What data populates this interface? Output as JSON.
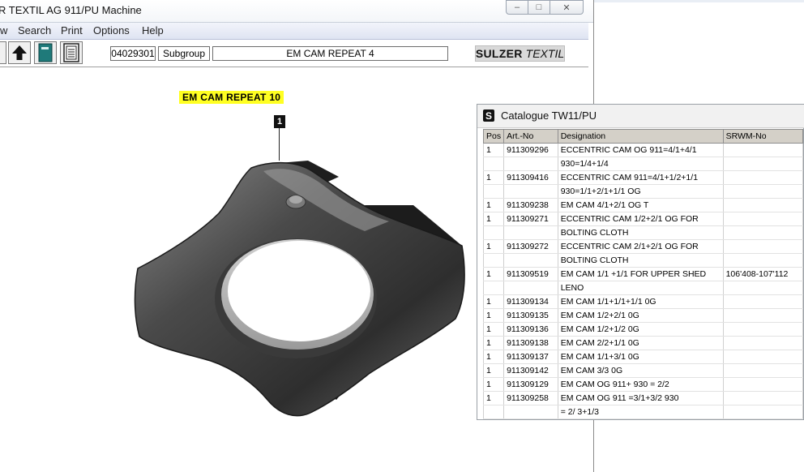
{
  "window": {
    "title": "R TEXTIL AG 911/PU Machine",
    "controls": {
      "minimize": "‒",
      "maximize": "□",
      "close": "✕"
    }
  },
  "menu": [
    "w",
    "Search",
    "Print",
    "Options",
    "Help"
  ],
  "toolbar": {
    "article_no": "04029301",
    "group": "Subgroup",
    "description": "EM CAM REPEAT 4",
    "logo_bold": "SULZER",
    "logo_italic": "TEXTIL"
  },
  "drawing": {
    "part_label": "EM CAM REPEAT 10",
    "callout": "1"
  },
  "catalogue": {
    "title": "Catalogue TW11/PU",
    "icon_letter": "S",
    "columns": [
      "Pos",
      "Art.-No",
      "Designation",
      "SRWM-No"
    ],
    "rows": [
      [
        "1",
        "911309296",
        "ECCENTRIC  CAM OG 911=4/1+4/1",
        ""
      ],
      [
        "",
        "",
        "930=1/4+1/4",
        ""
      ],
      [
        "1",
        "911309416",
        "ECCENTRIC  CAM 911=4/1+1/2+1/1",
        ""
      ],
      [
        "",
        "",
        "   930=1/1+2/1+1/1 OG",
        ""
      ],
      [
        "1",
        "911309238",
        "EM CAM 4/1+2/1 OG T",
        ""
      ],
      [
        "1",
        "911309271",
        "ECCENTRIC  CAM 1/2+2/1 OG FOR",
        ""
      ],
      [
        "",
        "",
        " BOLTING CLOTH",
        ""
      ],
      [
        "1",
        "911309272",
        "ECCENTRIC  CAM 2/1+2/1  OG FOR",
        ""
      ],
      [
        "",
        "",
        " BOLTING CLOTH",
        ""
      ],
      [
        "1",
        "911309519",
        "EM CAM 1/1 +1/1 FOR UPPER SHED",
        "106'408-107'112"
      ],
      [
        "",
        "",
        " LENO",
        ""
      ],
      [
        "1",
        "911309134",
        "EM CAM  1/1+1/1+1/1  0G",
        ""
      ],
      [
        "1",
        "911309135",
        "EM CAM  1/2+2/1   0G",
        ""
      ],
      [
        "1",
        "911309136",
        "EM CAM  1/2+1/2   0G",
        ""
      ],
      [
        "1",
        "911309138",
        "EM CAM  2/2+1/1   0G",
        ""
      ],
      [
        "1",
        "911309137",
        "EM CAM  1/1+3/1   0G",
        ""
      ],
      [
        "1",
        "911309142",
        "EM CAM  3/3  0G",
        ""
      ],
      [
        "1",
        "911309129",
        "EM CAM  OG  911+ 930 = 2/2",
        ""
      ],
      [
        "1",
        "911309258",
        "EM CAM  OG  911 =3/1+3/2  930",
        ""
      ],
      [
        "",
        "",
        "= 2/ 3+1/3",
        ""
      ]
    ]
  }
}
